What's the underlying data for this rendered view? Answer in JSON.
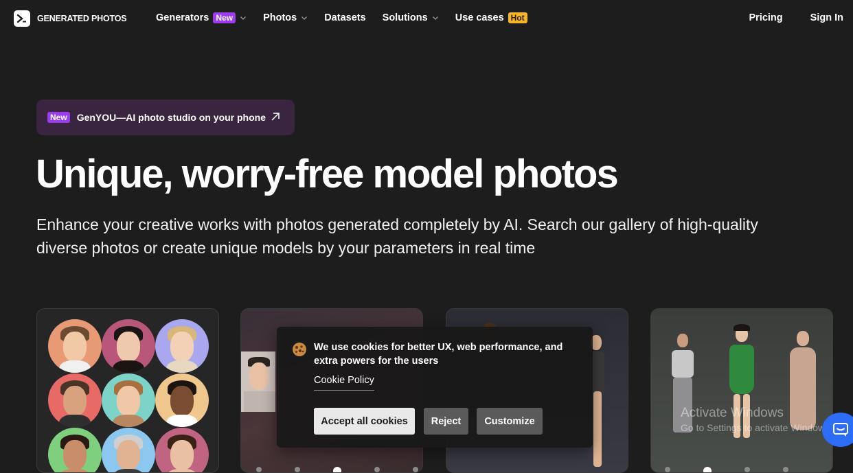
{
  "nav": {
    "logo_text": "GENERATED PHOTOS",
    "items": [
      {
        "label": "Generators",
        "badge": "New"
      },
      {
        "label": "Photos"
      },
      {
        "label": "Datasets"
      },
      {
        "label": "Solutions"
      },
      {
        "label": "Use cases",
        "badge": "Hot"
      }
    ],
    "pricing": "Pricing",
    "sign_in": "Sign In"
  },
  "promo": {
    "badge": "New",
    "text": "GenYOU—AI photo studio on your phone"
  },
  "hero": {
    "title": "Unique, worry-free model photos",
    "subtitle": "Enhance your creative works with photos generated completely by AI. Search our gallery of high-quality diverse photos or create unique models by your parameters in real time"
  },
  "cookie": {
    "message": "We use cookies for better UX, web performance, and extra powers for the users",
    "policy_link": "Cookie Policy",
    "accept": "Accept all cookies",
    "reject": "Reject",
    "customize": "Customize"
  },
  "watermark": {
    "title": "Activate Windows",
    "subtitle": "Go to Settings to activate Windows."
  },
  "colors": {
    "background": "#1d1d1d",
    "badge_new": "#9b3cf0",
    "badge_hot": "#f5b42a",
    "promo_bg": "#3a2540",
    "chat": "#2d6df6"
  }
}
